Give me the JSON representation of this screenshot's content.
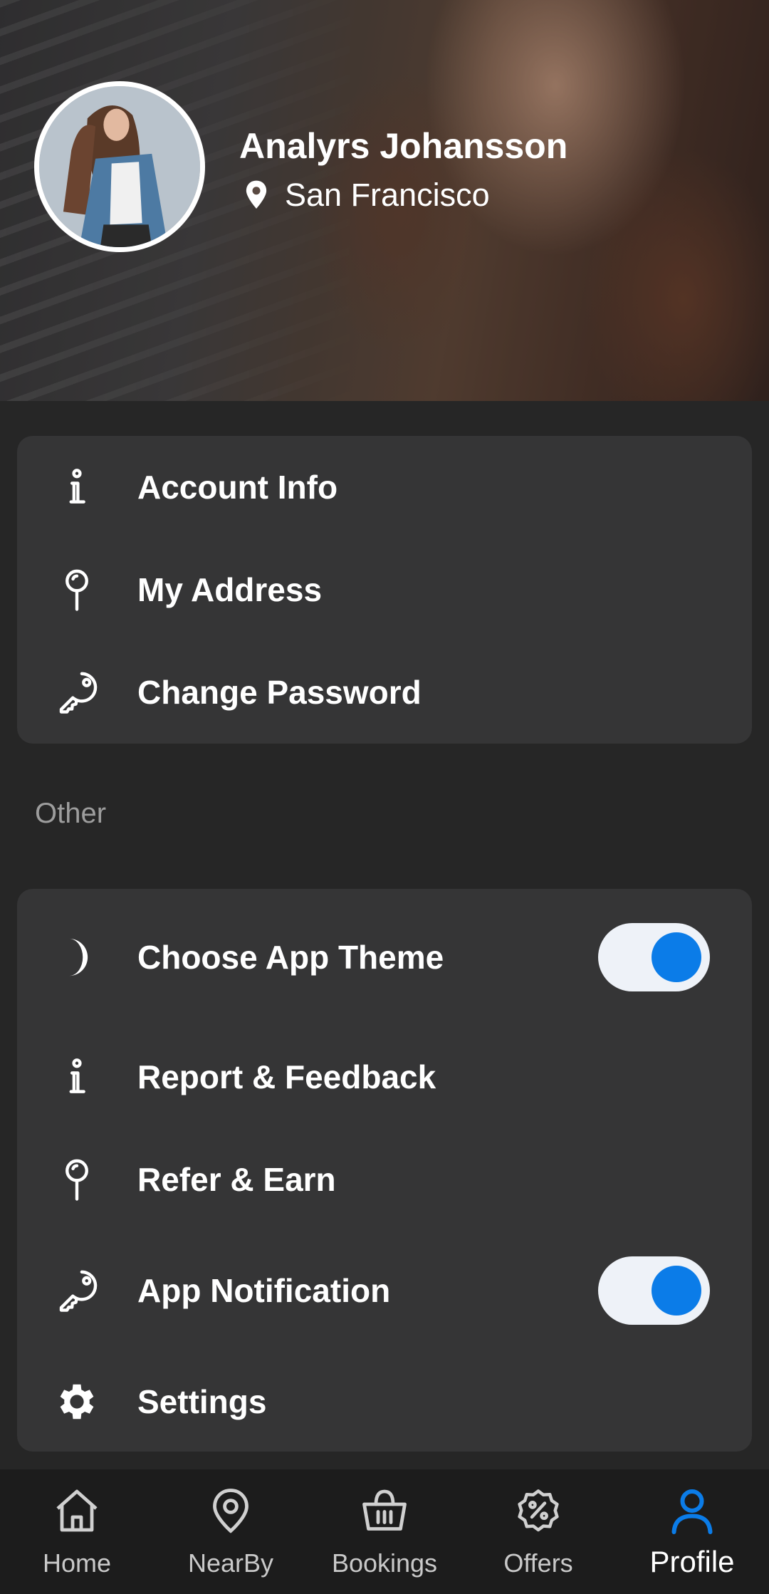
{
  "profile": {
    "name": "Analyrs Johansson",
    "location": "San Francisco"
  },
  "account_menu": [
    {
      "label": "Account Info",
      "icon": "info-icon"
    },
    {
      "label": "My Address",
      "icon": "map-pin-icon"
    },
    {
      "label": "Change Password",
      "icon": "key-icon"
    }
  ],
  "other_section": {
    "title": "Other",
    "items": [
      {
        "label": "Choose App Theme",
        "icon": "moon-icon",
        "toggle": true,
        "toggle_on": true
      },
      {
        "label": "Report & Feedback",
        "icon": "info-icon"
      },
      {
        "label": "Refer & Earn",
        "icon": "map-pin-icon"
      },
      {
        "label": "App Notification",
        "icon": "key-icon",
        "toggle": true,
        "toggle_on": true
      },
      {
        "label": "Settings",
        "icon": "gear-icon"
      }
    ]
  },
  "bottom_nav": [
    {
      "label": "Home",
      "icon": "home-icon"
    },
    {
      "label": "NearBy",
      "icon": "location-icon"
    },
    {
      "label": "Bookings",
      "icon": "basket-icon"
    },
    {
      "label": "Offers",
      "icon": "percent-badge-icon"
    },
    {
      "label": "Profile",
      "icon": "user-icon",
      "active": true
    }
  ],
  "colors": {
    "background": "#262626",
    "card": "#353536",
    "accent": "#0b7ce8",
    "toggle_track": "#eef2f8",
    "nav_background": "#1c1c1c",
    "muted_text": "#9d9d9d"
  }
}
